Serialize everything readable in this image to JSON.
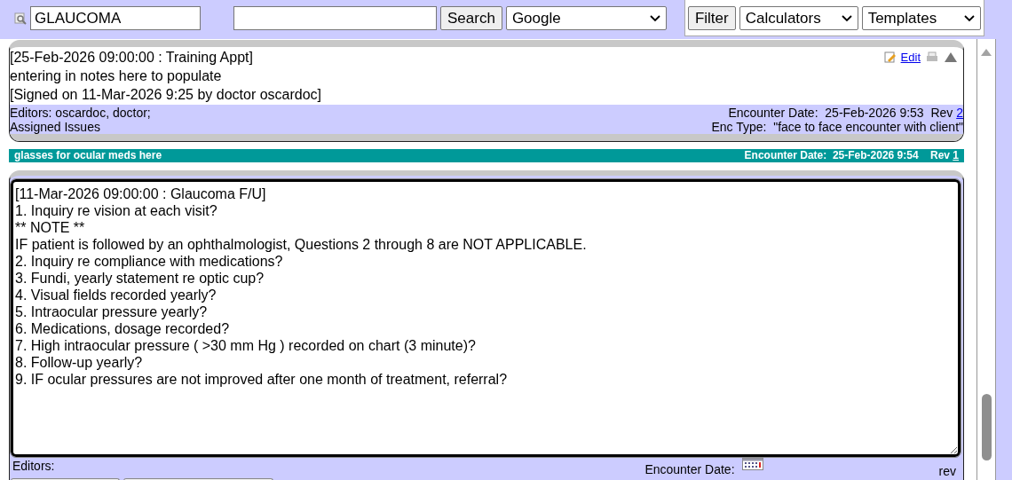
{
  "toolbar": {
    "quick_search": {
      "value": "GLAUCOMA"
    },
    "search_button": "Search",
    "engine_select": "Google",
    "filter_button": "Filter",
    "calculators_select": "Calculators",
    "templates_select": "Templates"
  },
  "notes": [
    {
      "kind": "signed",
      "lines": [
        "[25-Feb-2026 09:00:00 : Training Appt]",
        "entering in notes here to populate",
        "[Signed on 11-Mar-2026 9:25 by doctor oscardoc]"
      ],
      "edit_link": "Edit",
      "editors": "Editors: oscardoc, doctor;",
      "encounter_date_label": "Encounter Date:",
      "encounter_date": "25-Feb-2026 9:53",
      "rev_label": "Rev",
      "rev": "2",
      "issues": "Assigned Issues",
      "enc_type_label": "Enc Type:",
      "enc_type": "\"face to face encounter with client\""
    },
    {
      "kind": "banner",
      "title": "glasses for ocular meds here",
      "encounter_date_label": "Encounter Date:",
      "encounter_date": "25-Feb-2026 9:54",
      "rev_label": "Rev",
      "rev": "1"
    },
    {
      "kind": "editing",
      "lines": [
        "[11-Mar-2026 09:00:00 : Glaucoma F/U]",
        "1. Inquiry re vision at each visit?",
        "** NOTE **",
        "IF patient is followed by an ophthalmologist, Questions 2 through 8 are NOT APPLICABLE.",
        "2. Inquiry re compliance with medications?",
        "3. Fundi, yearly statement re optic cup?",
        "4. Visual fields recorded yearly?",
        "5. Intraocular pressure yearly?",
        "6. Medications, dosage recorded?",
        "7. High intraocular pressure ( >30 mm Hg ) recorded on chart (3 minute)?",
        "8. Follow-up yearly?",
        "9. IF ocular pressures are not improved after one month of treatment, referral?"
      ],
      "editors": "Editors:",
      "encounter_date_label": "Encounter Date:",
      "rev_label": "rev"
    }
  ]
}
